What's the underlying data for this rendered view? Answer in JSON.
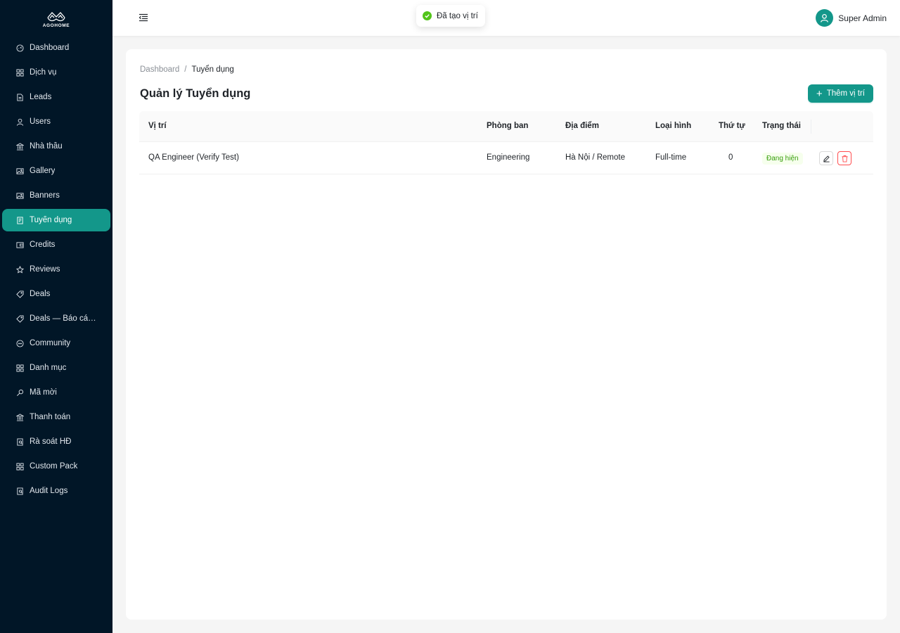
{
  "brand": {
    "name": "AGOHOME"
  },
  "sidebar": {
    "items": [
      {
        "label": "Dashboard",
        "icon": "dashboard-icon"
      },
      {
        "label": "Dịch vụ",
        "icon": "appstore-icon"
      },
      {
        "label": "Leads",
        "icon": "file-icon"
      },
      {
        "label": "Users",
        "icon": "user-icon"
      },
      {
        "label": "Nhà thầu",
        "icon": "bank-icon"
      },
      {
        "label": "Gallery",
        "icon": "picture-icon"
      },
      {
        "label": "Banners",
        "icon": "picture-icon"
      },
      {
        "label": "Tuyển dụng",
        "icon": "solution-icon",
        "active": true
      },
      {
        "label": "Credits",
        "icon": "wallet-icon"
      },
      {
        "label": "Reviews",
        "icon": "star-icon"
      },
      {
        "label": "Deals",
        "icon": "tag-icon"
      },
      {
        "label": "Deals — Báo cáo ...",
        "icon": "tag-icon"
      },
      {
        "label": "Community",
        "icon": "message-icon"
      },
      {
        "label": "Danh mục",
        "icon": "appstore-icon"
      },
      {
        "label": "Mã mời",
        "icon": "key-icon"
      },
      {
        "label": "Thanh toán",
        "icon": "bank-icon"
      },
      {
        "label": "Rà soát HĐ",
        "icon": "file-search-icon"
      },
      {
        "label": "Custom Pack",
        "icon": "appstore-icon"
      },
      {
        "label": "Audit Logs",
        "icon": "file-search-icon"
      }
    ]
  },
  "header": {
    "user_name": "Super Admin"
  },
  "toast": {
    "message": "Đã tạo vị trí",
    "status_color": "#52c41a"
  },
  "breadcrumb": {
    "root": "Dashboard",
    "separator": "/",
    "current": "Tuyển dụng"
  },
  "page": {
    "title": "Quản lý Tuyển dụng",
    "add_button": "Thêm vị trí"
  },
  "table": {
    "columns": [
      "Vị trí",
      "Phòng ban",
      "Địa điểm",
      "Loại hình",
      "Thứ tự",
      "Trạng thái"
    ],
    "rows": [
      {
        "position": "QA Engineer (Verify Test)",
        "department": "Engineering",
        "location": "Hà Nội / Remote",
        "type": "Full-time",
        "order": "0",
        "status": "Đang hiện"
      }
    ]
  },
  "colors": {
    "sidebar_bg": "#011627",
    "accent": "#13978a",
    "danger": "#ff4d4f",
    "success": "#52c41a"
  }
}
